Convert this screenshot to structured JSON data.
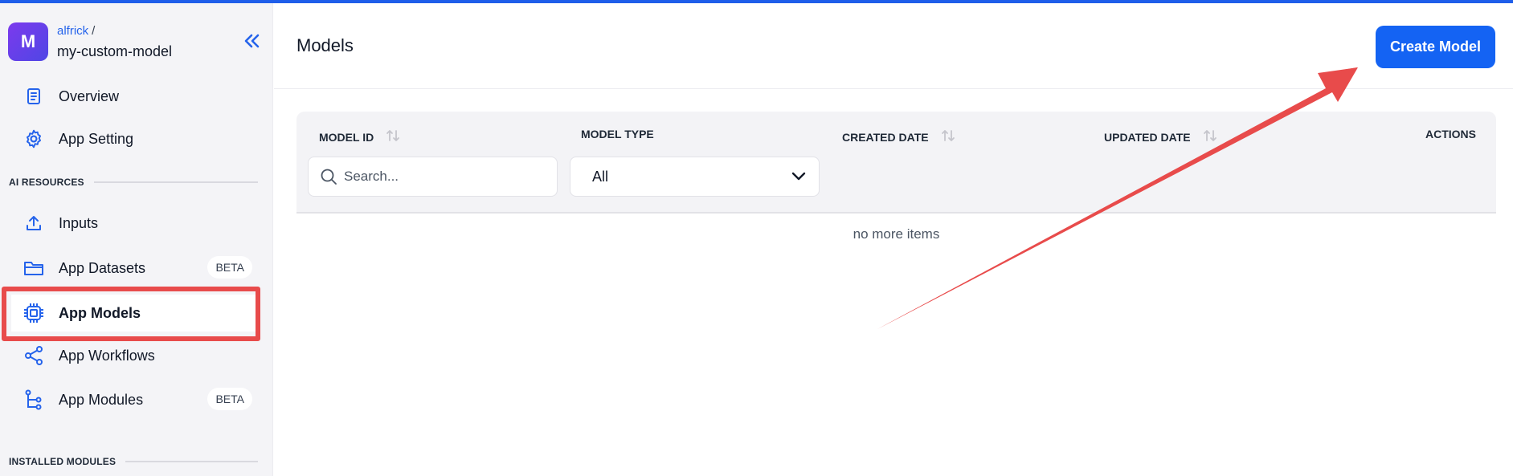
{
  "app": {
    "avatar_letter": "M",
    "owner": "alfrick",
    "separator": "/",
    "name": "my-custom-model"
  },
  "sidebar": {
    "items": [
      {
        "label": "Overview",
        "icon": "document-icon"
      },
      {
        "label": "App Setting",
        "icon": "gear-icon"
      }
    ],
    "ai_resources_heading": "AI RESOURCES",
    "resources": [
      {
        "label": "Inputs",
        "icon": "upload-icon",
        "badge": ""
      },
      {
        "label": "App Datasets",
        "icon": "folder-icon",
        "badge": "BETA"
      },
      {
        "label": "App Models",
        "icon": "chip-icon",
        "badge": "",
        "active": true
      },
      {
        "label": "App Workflows",
        "icon": "share-icon",
        "badge": ""
      },
      {
        "label": "App Modules",
        "icon": "tree-icon",
        "badge": "BETA"
      }
    ],
    "installed_modules_heading": "INSTALLED MODULES"
  },
  "main": {
    "title": "Models",
    "create_button": "Create Model",
    "table": {
      "columns": [
        "MODEL ID",
        "MODEL TYPE",
        "CREATED DATE",
        "UPDATED DATE",
        "ACTIONS"
      ],
      "search_placeholder": "Search...",
      "type_filter_value": "All",
      "empty_text": "no more items"
    }
  },
  "colors": {
    "accent": "#1463f3",
    "annotation": "#e84b4b",
    "top_bar": "#1f5eea"
  }
}
